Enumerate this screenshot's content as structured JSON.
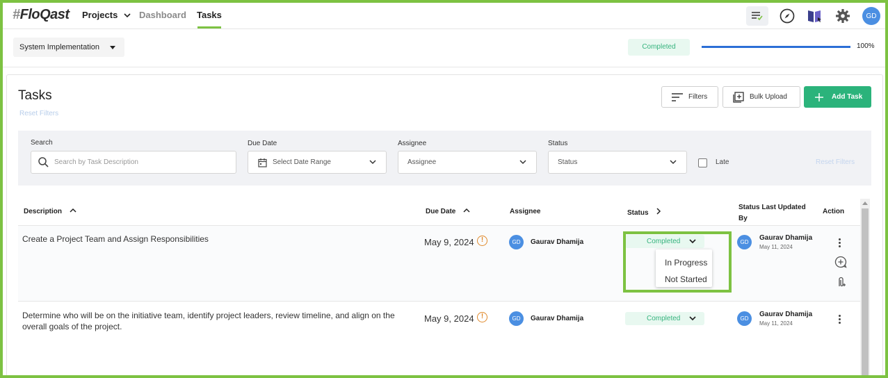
{
  "nav": {
    "logo_hash": "#",
    "logo_text": "FloQast",
    "projects": "Projects",
    "dashboard": "Dashboard",
    "tasks": "Tasks",
    "avatar": "GD"
  },
  "project": {
    "selected": "System Implementation",
    "status": "Completed",
    "progress_percent": 100,
    "progress_label": "100%"
  },
  "page": {
    "title": "Tasks",
    "reset_filters": "Reset Filters",
    "filters_button": "Filters",
    "bulk_upload_button": "Bulk Upload",
    "add_task_button": "Add Task"
  },
  "filters": {
    "search_label": "Search",
    "search_placeholder": "Search by Task Description",
    "due_date_label": "Due Date",
    "due_date_value": "Select Date Range",
    "assignee_label": "Assignee",
    "assignee_value": "Assignee",
    "status_label": "Status",
    "status_value": "Status",
    "late_label": "Late",
    "reset_filters": "Reset Filters"
  },
  "table": {
    "headers": {
      "description": "Description",
      "due_date": "Due Date",
      "assignee": "Assignee",
      "status": "Status",
      "status_updated_line1": "Status Last Updated",
      "status_updated_line2": "By",
      "action": "Action"
    },
    "rows": [
      {
        "description": "Create a Project Team and Assign Responsibilities",
        "due_date": "May 9, 2024",
        "assignee_initials": "GD",
        "assignee": "Gaurav Dhamija",
        "status": "Completed",
        "updated_by_initials": "GD",
        "updated_by": "Gaurav Dhamija",
        "updated_date": "May 11, 2024"
      },
      {
        "description": "Determine who will be on the initiative team, identify project leaders, review timeline, and align on the overall goals of the project.",
        "due_date": "May 9, 2024",
        "assignee_initials": "GD",
        "assignee": "Gaurav Dhamija",
        "status": "Completed",
        "updated_by_initials": "GD",
        "updated_by": "Gaurav Dhamija",
        "updated_date": "May 11, 2024"
      }
    ]
  },
  "status_dropdown": {
    "options": [
      "In Progress",
      "Not Started"
    ]
  },
  "colors": {
    "accent_green": "#2bb37b",
    "highlight_green": "#7dc242",
    "status_text": "#36b37e",
    "avatar_blue": "#4b8fe2",
    "warning_orange": "#e0892b"
  }
}
